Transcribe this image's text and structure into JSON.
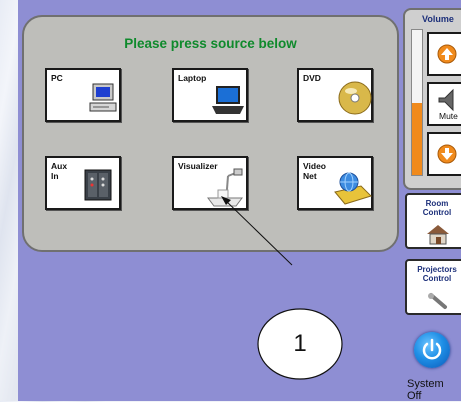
{
  "panel": {
    "title": "Please press source below"
  },
  "sources": [
    {
      "label": "PC",
      "icon": "computer-icon"
    },
    {
      "label": "Laptop",
      "icon": "laptop-icon"
    },
    {
      "label": "DVD",
      "icon": "dvd-icon"
    },
    {
      "label": "Aux\nIn",
      "icon": "aux-input-icon"
    },
    {
      "label": "Visualizer",
      "icon": "document-camera-icon"
    },
    {
      "label": "Video\nNet",
      "icon": "video-network-icon"
    }
  ],
  "volume": {
    "title": "Volume",
    "mute_label": "Mute",
    "level_fraction": 0.5,
    "level_color": "#f08a1c"
  },
  "side_controls": {
    "room_label": "Room\nControl",
    "projectors_label": "Projectors\nControl"
  },
  "system": {
    "off_label": "System Off"
  },
  "callout": {
    "number": "1"
  },
  "colors": {
    "background": "#8e8ed3",
    "panel": "#bebeba",
    "title_green": "#0f8a2c",
    "power_blue": "#1f8fe6"
  }
}
